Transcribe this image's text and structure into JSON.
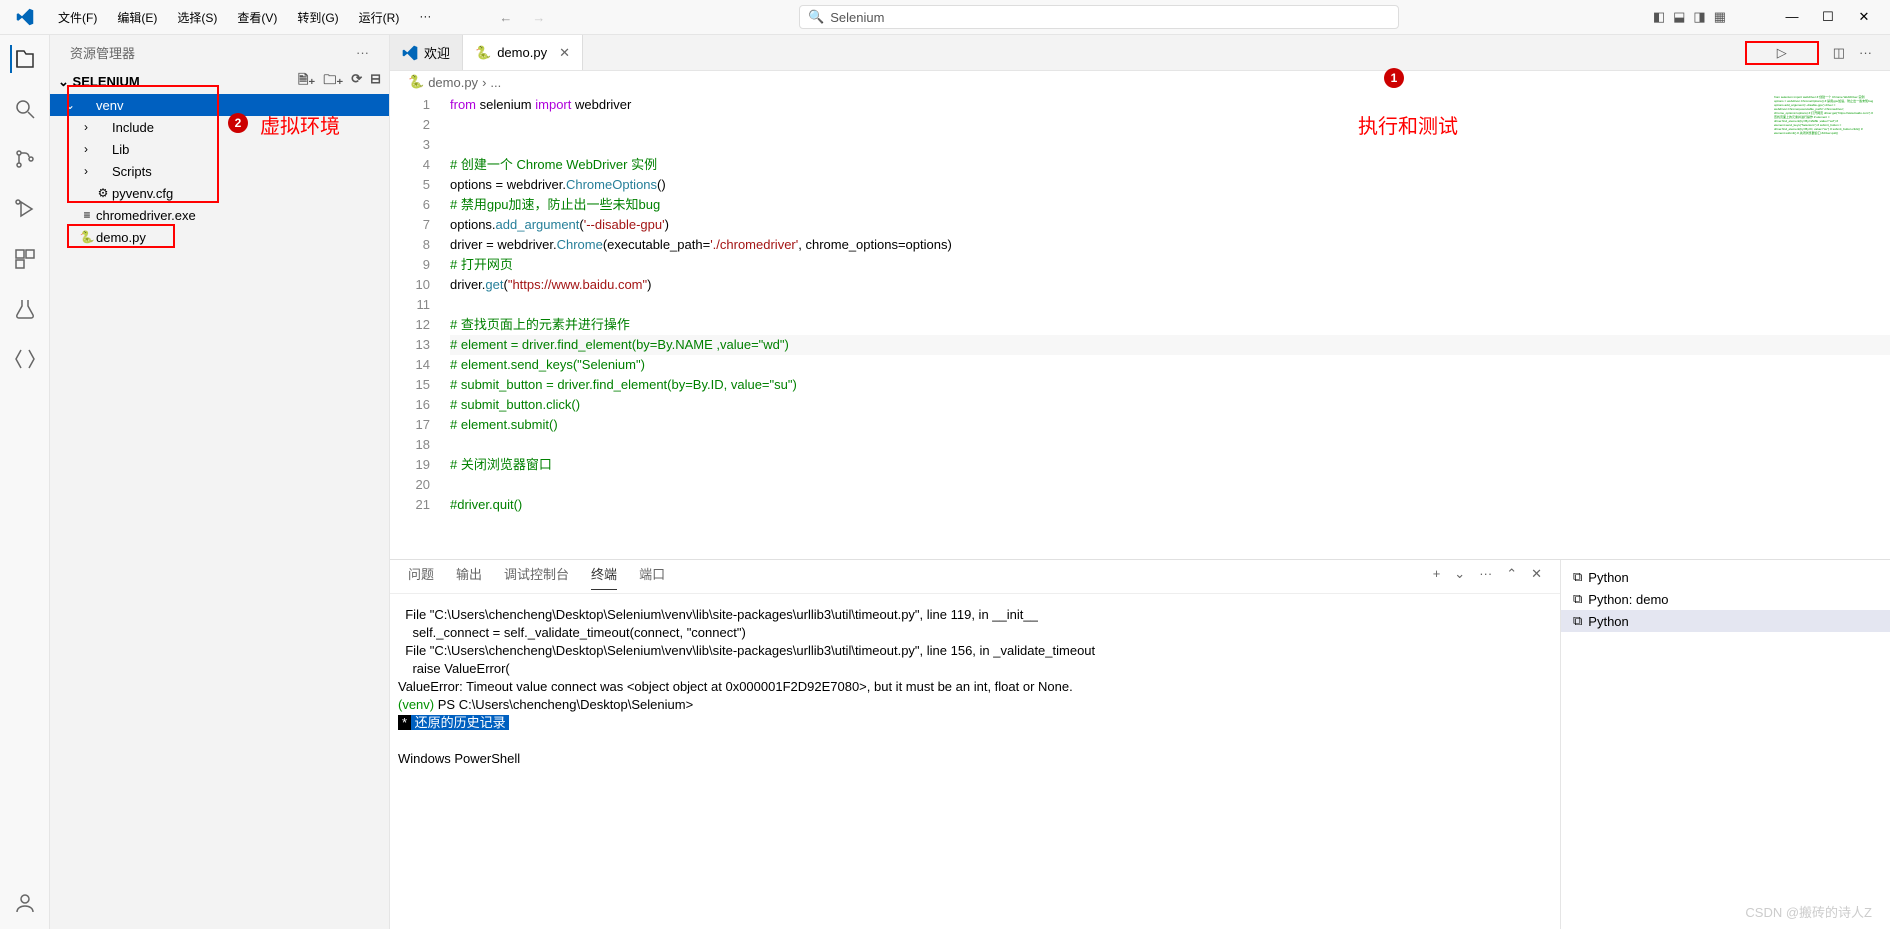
{
  "titlebar": {
    "menus": [
      "文件(F)",
      "编辑(E)",
      "选择(S)",
      "查看(V)",
      "转到(G)",
      "运行(R)",
      "···"
    ],
    "search_text": "Selenium"
  },
  "sidebar": {
    "title": "资源管理器",
    "folder": "SELENIUM",
    "tree": [
      {
        "label": "venv",
        "depth": 0,
        "chev": "⌄",
        "selected": true
      },
      {
        "label": "Include",
        "depth": 1,
        "chev": "›"
      },
      {
        "label": "Lib",
        "depth": 1,
        "chev": "›"
      },
      {
        "label": "Scripts",
        "depth": 1,
        "chev": "›"
      },
      {
        "label": "pyvenv.cfg",
        "depth": 1,
        "chev": "",
        "icon": "⚙"
      },
      {
        "label": "chromedriver.exe",
        "depth": 0,
        "chev": "",
        "icon": "≡"
      },
      {
        "label": "demo.py",
        "depth": 0,
        "chev": "",
        "icon": "🐍"
      }
    ]
  },
  "tabs": [
    {
      "label": "欢迎",
      "icon": "vs"
    },
    {
      "label": "demo.py",
      "icon": "py",
      "active": true,
      "close": true
    }
  ],
  "breadcrumb": [
    "demo.py",
    "..."
  ],
  "code": {
    "lines": [
      {
        "n": 1,
        "seg": [
          [
            "kw2",
            "from"
          ],
          [
            "",
            " selenium "
          ],
          [
            "kw2",
            "import"
          ],
          [
            "",
            " webdriver"
          ]
        ]
      },
      {
        "n": 2,
        "seg": []
      },
      {
        "n": 3,
        "seg": []
      },
      {
        "n": 4,
        "seg": [
          [
            "cmt",
            "# 创建一个 Chrome WebDriver 实例"
          ]
        ]
      },
      {
        "n": 5,
        "seg": [
          [
            "",
            "options = webdriver."
          ],
          [
            "fn",
            "ChromeOptions"
          ],
          [
            "",
            "()"
          ]
        ]
      },
      {
        "n": 6,
        "seg": [
          [
            "cmt",
            "# 禁用gpu加速，防止出一些未知bug"
          ]
        ]
      },
      {
        "n": 7,
        "seg": [
          [
            "",
            "options."
          ],
          [
            "fn",
            "add_argument"
          ],
          [
            "",
            "("
          ],
          [
            "str",
            "'--disable-gpu'"
          ],
          [
            "",
            ")"
          ]
        ]
      },
      {
        "n": 8,
        "seg": [
          [
            "",
            "driver = webdriver."
          ],
          [
            "fn",
            "Chrome"
          ],
          [
            "",
            "("
          ],
          [
            "",
            "executable_path"
          ],
          [
            "",
            "="
          ],
          [
            "str",
            "'./chromedriver'"
          ],
          [
            "",
            ", "
          ],
          [
            "",
            "chrome_options"
          ],
          [
            "",
            "=options)"
          ]
        ]
      },
      {
        "n": 9,
        "seg": [
          [
            "cmt",
            "# 打开网页"
          ]
        ]
      },
      {
        "n": 10,
        "seg": [
          [
            "",
            "driver."
          ],
          [
            "fn",
            "get"
          ],
          [
            "",
            "("
          ],
          [
            "str",
            "\"https://www.baidu.com\""
          ],
          [
            "",
            ")"
          ]
        ]
      },
      {
        "n": 11,
        "seg": []
      },
      {
        "n": 12,
        "seg": [
          [
            "cmt",
            "# 查找页面上的元素并进行操作"
          ]
        ]
      },
      {
        "n": 13,
        "seg": [
          [
            "cmt",
            "# element = driver.find_element(by=By.NAME ,value=\"wd\")"
          ]
        ]
      },
      {
        "n": 14,
        "seg": [
          [
            "cmt",
            "# element.send_keys(\"Selenium\")"
          ]
        ]
      },
      {
        "n": 15,
        "seg": [
          [
            "cmt",
            "# submit_button = driver.find_element(by=By.ID, value=\"su\")"
          ]
        ]
      },
      {
        "n": 16,
        "seg": [
          [
            "cmt",
            "# submit_button.click()"
          ]
        ]
      },
      {
        "n": 17,
        "seg": [
          [
            "cmt",
            "# element.submit()"
          ]
        ]
      },
      {
        "n": 18,
        "seg": []
      },
      {
        "n": 19,
        "seg": [
          [
            "cmt",
            "# 关闭浏览器窗口"
          ]
        ]
      },
      {
        "n": 20,
        "seg": []
      },
      {
        "n": 21,
        "seg": [
          [
            "cmt",
            "#driver.quit()"
          ]
        ]
      }
    ],
    "active_line": 13
  },
  "panel": {
    "tabs": [
      "问题",
      "输出",
      "调试控制台",
      "终端",
      "端口"
    ],
    "active": "终端",
    "terminal_text": "  File \"C:\\Users\\chencheng\\Desktop\\Selenium\\venv\\lib\\site-packages\\urllib3\\util\\timeout.py\", line 119, in __init__\n    self._connect = self._validate_timeout(connect, \"connect\")\n  File \"C:\\Users\\chencheng\\Desktop\\Selenium\\venv\\lib\\site-packages\\urllib3\\util\\timeout.py\", line 156, in _validate_timeout\n    raise ValueError(\nValueError: Timeout value connect was <object object at 0x000001F2D92E7080>, but it must be an int, float or None.",
    "prompt_venv": "(venv) ",
    "prompt_path": "PS C:\\Users\\chencheng\\Desktop\\Selenium>",
    "hist_star": "*",
    "hist_text": " 还原的历史记录 ",
    "ps": "Windows PowerShell",
    "terms": [
      "Python",
      "Python: demo",
      "Python"
    ],
    "term_active": 2
  },
  "annotations": {
    "a1": "执行和测试",
    "a2": "虚拟环境",
    "badge1": "1",
    "badge2": "2"
  },
  "watermark": "CSDN @搬砖的诗人Z"
}
